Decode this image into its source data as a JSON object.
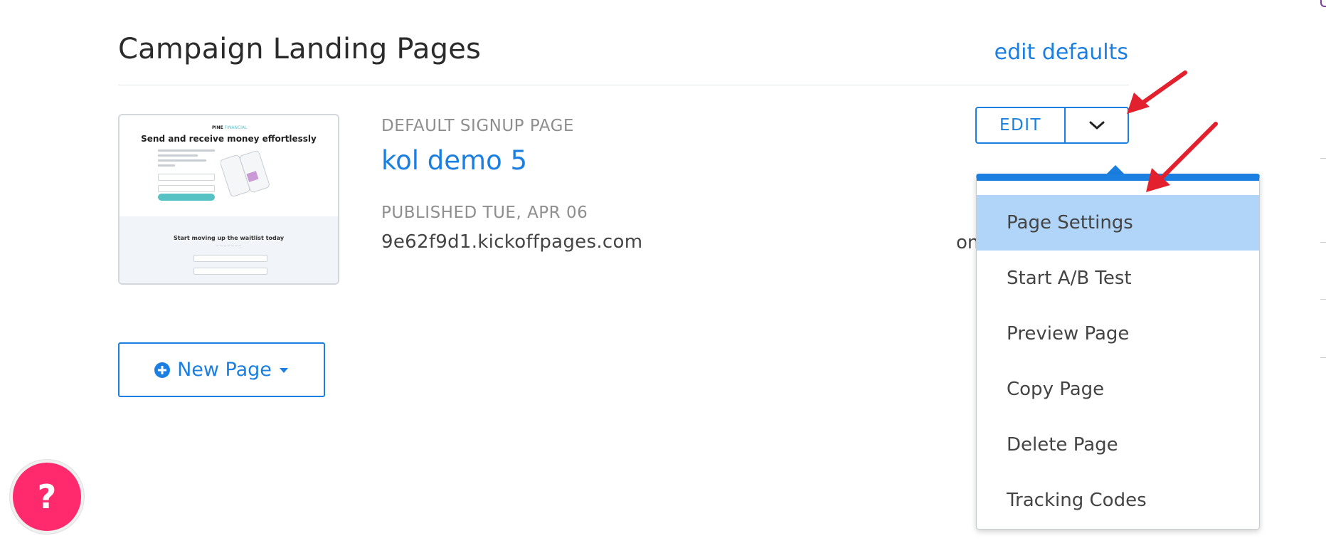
{
  "header": {
    "title": "Campaign Landing Pages",
    "edit_defaults": "edit defaults"
  },
  "page_card": {
    "thumbnail": {
      "brand_a": "PINE",
      "brand_b": "FINANCIAL",
      "hero": "Send and receive money effortlessly",
      "waitlist": "Start moving up the waitlist today"
    },
    "label": "DEFAULT SIGNUP PAGE",
    "name": "kol demo 5",
    "published": "PUBLISHED TUE, APR 06",
    "domain": "9e62f9d1.kickoffpages.com",
    "truncated_text": "on"
  },
  "actions": {
    "edit_label": "EDIT",
    "dropdown_icon": "chevron-down-icon"
  },
  "menu": {
    "items": [
      {
        "label": "Page Settings",
        "active": true
      },
      {
        "label": "Start A/B Test",
        "active": false
      },
      {
        "label": "Preview Page",
        "active": false
      },
      {
        "label": "Copy Page",
        "active": false
      },
      {
        "label": "Delete Page",
        "active": false
      },
      {
        "label": "Tracking Codes",
        "active": false
      }
    ]
  },
  "new_page": {
    "label": "New Page",
    "icon": "plus-circle-icon",
    "caret_icon": "caret-down-icon"
  },
  "help": {
    "label": "?"
  },
  "colors": {
    "accent": "#1a7fe0",
    "menu_highlight": "#b1d5f8",
    "help": "#ff2a6d",
    "annotation_arrow": "#e3202d"
  }
}
